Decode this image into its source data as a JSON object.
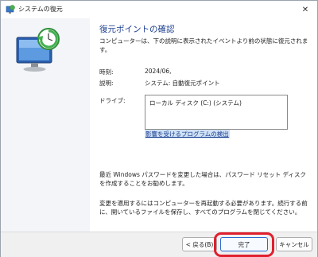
{
  "window": {
    "title": "システムの復元"
  },
  "main": {
    "heading": "復元ポイントの確認",
    "subtitle": "コンピューターは、下の説明に表示されたイベントより前の状態に復元されます。",
    "time_label": "時刻:",
    "time_value": "2024/06,",
    "desc_label": "説明:",
    "desc_value": "システム: 自動復元ポイント",
    "drives_label": "ドライブ:",
    "drives": [
      "ローカル ディスク (C:) (システム)"
    ],
    "scan_link": "影響を受けるプログラムの検出",
    "note_password": "最近 Windows パスワードを変更した場合は、パスワード リセット ディスクを作成することをお勧めします。",
    "note_restart": "変更を適用するにはコンピューターを再起動する必要があります。続行する前に、開いているファイルを保存し、すべてのプログラムを閉じてください。"
  },
  "footer": {
    "back_label": "< 戻る(B)",
    "finish_label": "完了",
    "cancel_label": "キャンセル"
  },
  "colors": {
    "accent": "#1a3d8f",
    "highlight": "#e0202e",
    "panel": "#f3f5f8"
  },
  "icons": {
    "title": "system-restore-icon",
    "hero": "system-restore-monitor-icon",
    "close": "close-icon"
  }
}
